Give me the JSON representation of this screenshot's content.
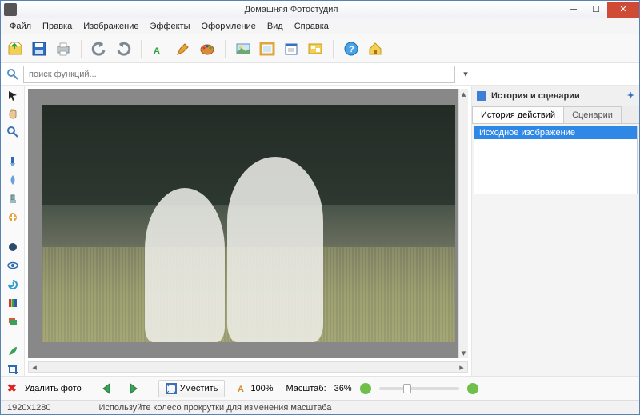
{
  "window": {
    "title": "Домашняя Фотостудия"
  },
  "menu": [
    "Файл",
    "Правка",
    "Изображение",
    "Эффекты",
    "Оформление",
    "Вид",
    "Справка"
  ],
  "search": {
    "placeholder": "поиск функций..."
  },
  "rightPanel": {
    "title": "История и сценарии",
    "tabs": [
      "История действий",
      "Сценарии"
    ],
    "historyItems": [
      "Исходное изображение"
    ]
  },
  "bottom": {
    "deleteLabel": "Удалить фото",
    "fitLabel": "Уместить",
    "hundred": "100%",
    "zoomLabel": "Масштаб:",
    "zoomValue": "36%"
  },
  "status": {
    "dimensions": "1920x1280",
    "hint": "Используйте колесо прокрутки для изменения масштаба"
  }
}
